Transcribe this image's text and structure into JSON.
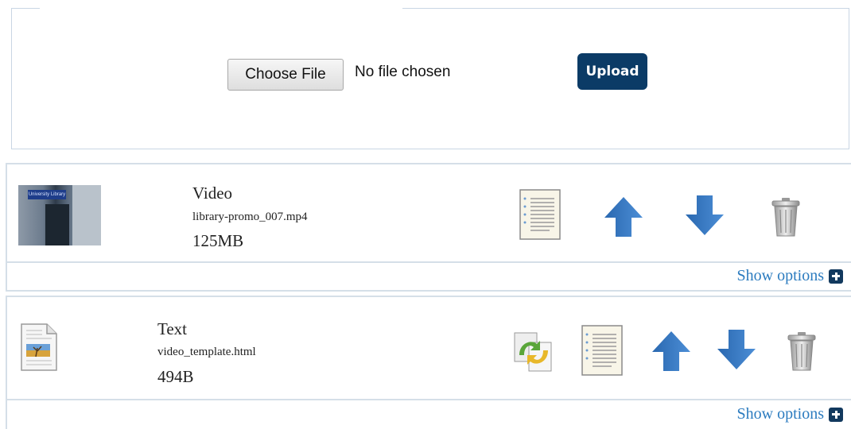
{
  "upload": {
    "choose_file_label": "Choose File",
    "file_status": "No file chosen",
    "upload_label": "Upload"
  },
  "files": [
    {
      "type": "Video",
      "name": "library-promo_007.mp4",
      "size": "125MB",
      "thumbnail": "library-entrance-photo",
      "thumb_sign": "University Library",
      "actions": [
        "notes-icon",
        "move-up-icon",
        "move-down-icon",
        "trash-icon"
      ],
      "show_options_label": "Show options"
    },
    {
      "type": "Text",
      "name": "video_template.html",
      "size": "494B",
      "thumbnail": "html-document-icon",
      "actions": [
        "replace-icon",
        "notes-icon",
        "move-up-icon",
        "move-down-icon",
        "trash-icon"
      ],
      "show_options_label": "Show options"
    }
  ],
  "colors": {
    "upload_button": "#0b3b66",
    "link": "#2b7bbf",
    "arrow": "#2f6fb5",
    "border": "#d5dfe8"
  }
}
